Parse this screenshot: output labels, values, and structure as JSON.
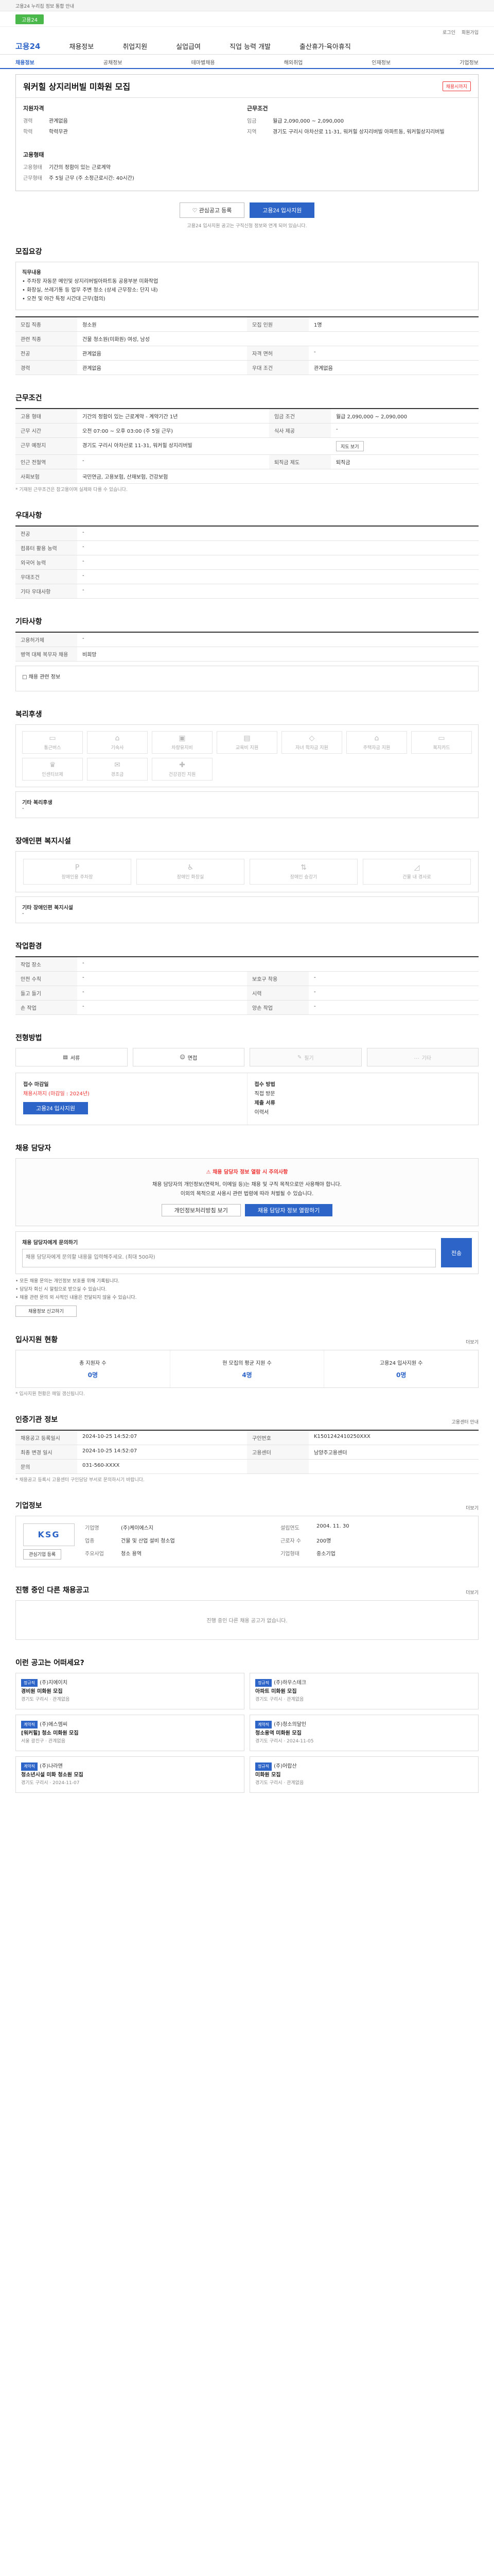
{
  "topbar": {
    "notice": "고용24 누리집 정보 통합 안내"
  },
  "banner": {
    "label": "고용24"
  },
  "util": [
    "로그인",
    "회원가입"
  ],
  "gnb": {
    "logo": "고용24",
    "menu": [
      "채용정보",
      "취업지원",
      "실업급여",
      "직업 능력 개발",
      "출산휴가·육아휴직"
    ]
  },
  "snb": [
    "채용정보",
    "공채정보",
    "테마별채용",
    "해외취업",
    "인재정보",
    "기업정보"
  ],
  "job": {
    "title": "워커힐 상지리버빌 미화원 모집",
    "status": "채용시까지",
    "left_head": "지원자격",
    "left": [
      {
        "k": "경력",
        "v": "관계없음"
      },
      {
        "k": "학력",
        "v": "학력무관"
      }
    ],
    "right_head": "근무조건",
    "right": [
      {
        "k": "임금",
        "v": "월급 2,090,000 ~ 2,090,000"
      },
      {
        "k": "지역",
        "v": "경기도 구리시 아차산로 11-31, 워커힐 상지리버빌 아파트동, 워커힐상지리버빌"
      }
    ],
    "corp_head": "고용형태",
    "corp": [
      {
        "k": "고용형태",
        "v": "기간의 정함이 있는 근로계약"
      },
      {
        "k": "근무형태",
        "v": "주 5일 근무 (주 소정근로시간: 40시간)"
      }
    ],
    "btn_scrap": "관심공고 등록",
    "btn_apply": "고용24 입사지원",
    "note": "고용24 입사지원 공고는 구직신청 정보와 연계 되어 있습니다."
  },
  "duty": {
    "title": "모집요강",
    "box_head": "직무내용",
    "box_lines": [
      "• 주차장 자동문 메인및 상지리버빌아파트동 공용부분 미화작업",
      "• 화장실, 쓰레기통 등 업무 주변 청소 (상세 근무장소: 단지 내)",
      "• 오전 및 야간 특정 시간대 근무(협의)"
    ],
    "rows": [
      {
        "k": "모집 직종",
        "v": "청소원"
      },
      {
        "k": "모집 인원",
        "v": "1명"
      },
      {
        "k": "관련 직종",
        "v": "건물 청소원(미화원) 여성, 남성"
      },
      {
        "k": "전공",
        "v": "관계없음"
      },
      {
        "k": "자격 면허",
        "v": "-"
      },
      {
        "k": "경력",
        "v": "관계없음"
      },
      {
        "k": "우대 조건",
        "v": "관계없음"
      }
    ]
  },
  "work": {
    "title": "근무조건",
    "rows": [
      {
        "k": "고용 형태",
        "v": "기간의 정함이 있는 근로계약 - 계약기간 1년"
      },
      {
        "k": "임금 조건",
        "v": "월급 2,090,000 ~ 2,090,000"
      },
      {
        "k": "근무 시간",
        "v": "오전 07:00 ~ 오후 03:00 (주 5일 근무)"
      },
      {
        "k": "식사 제공",
        "v": "-"
      },
      {
        "k": "근무 예정지",
        "v": "경기도 구리시 아차산로 11-31, 워커힐 상지리버빌"
      },
      {
        "k": "인근 전철역",
        "v": "-"
      },
      {
        "k": "퇴직금 제도",
        "v": "퇴직금"
      },
      {
        "k": "사회보험",
        "v": "국민연금, 고용보험, 산재보험, 건강보험"
      }
    ],
    "map_btn": "지도 보기",
    "note": "* 기재된 근무조건은 참고용이며 실제와 다를 수 있습니다."
  },
  "prefs": {
    "title": "우대사항",
    "rows": [
      {
        "k": "전공",
        "v": "-"
      },
      {
        "k": "컴퓨터 활용 능력",
        "v": "-"
      },
      {
        "k": "외국어 능력",
        "v": "-"
      },
      {
        "k": "우대조건",
        "v": "-"
      },
      {
        "k": "기타 우대사항",
        "v": "-"
      }
    ]
  },
  "etc": {
    "title": "기타사항",
    "rows": [
      {
        "k": "고용허가제",
        "v": "-"
      },
      {
        "k": "병역 대체 복무자 채용",
        "v": "비희망"
      }
    ],
    "extra": "□ 채용 관련 정보"
  },
  "welfare": {
    "title": "복리후생",
    "items": [
      "통근버스",
      "기숙사",
      "차량유지비",
      "교육비 지원",
      "자녀 학자금 지원",
      "주택자금 지원",
      "복지카드",
      "인센티브제",
      "경조금",
      "건강검진 지원"
    ],
    "other_head": "기타 복리후생",
    "other": "-"
  },
  "disability": {
    "title": "장애인편 복지시설",
    "items": [
      "장애인용 주차장",
      "장애인 화장실",
      "장애인 승강기",
      "건물 내 경사로"
    ],
    "other_head": "기타 장애인편 복지시설",
    "other": "-"
  },
  "workenv": {
    "title": "작업환경",
    "rows": [
      {
        "k": "작업 장소",
        "v": "-",
        "k2": "",
        "v2": ""
      },
      {
        "k": "안전 수칙",
        "v": "-",
        "k2": "보호구 착용",
        "v2": "-"
      },
      {
        "k": "들고 들기",
        "v": "-",
        "k2": "시력",
        "v2": "-"
      },
      {
        "k": "손 작업",
        "v": "-",
        "k2": "양손 작업",
        "v2": "-"
      }
    ]
  },
  "method": {
    "title": "전형방법",
    "items": [
      {
        "t": "서류",
        "dis": false
      },
      {
        "t": "면접",
        "dis": false
      },
      {
        "t": "필기",
        "dis": true
      },
      {
        "t": "기타",
        "dis": true
      }
    ],
    "col1_head": "접수 마감일",
    "col1_val": "채용시까지 (마감일 : 2024년)",
    "col1_btn": "고용24 입사지원",
    "col2_head": "접수 방법",
    "col2_val": "직접 방문",
    "col2_head2": "제출 서류",
    "col2_val2": "이력서"
  },
  "manager": {
    "title": "채용 담당자",
    "alert_head": "채용 담당자 정보 열람 시 주의사항",
    "alert_lines": [
      "채용 담당자의 개인정보(연락처, 이메일 등)는 채용 및 구직 목적으로만 사용해야 합니다.",
      "이외의 목적으로 사용시 관련 법령에 따라 처벌될 수 있습니다."
    ],
    "btn1": "개인정보처리방침 보기",
    "btn2": "채용 담당자 정보 열람하기",
    "form_head": "채용 담당자에게 문의하기",
    "form_placeholder": "채용 담당자에게 문의할 내용을 입력해주세요. (최대 500자)",
    "form_btn": "전송",
    "bullets": [
      "• 모든 채용 문의는 개인정보 보호를 위해 기록됩니다.",
      "• 담당자 회신 시 알림으로 받으실 수 있습니다.",
      "• 채용 관련 문의 외 사적인 내용은 전달되지 않을 수 있습니다."
    ],
    "btn3": "채용정보 신고하기"
  },
  "applicants": {
    "title": "입사지원 현황",
    "more": "더보기",
    "items": [
      {
        "k": "총 지원자 수",
        "v": "0명"
      },
      {
        "k": "현 모집의 평균 지원 수",
        "v": "4명"
      },
      {
        "k": "고용24 입사지원 수",
        "v": "0명"
      }
    ],
    "note": "* 입사지원 현황은 매일 갱신됩니다."
  },
  "regist": {
    "title": "인증기관 정보",
    "more": "고용센터 안내",
    "rows": [
      {
        "k": "채용공고 등록일시",
        "v": "2024-10-25 14:52:07",
        "k2": "구인번호",
        "v2": "K1501242410250XXX"
      },
      {
        "k": "최종 변경 일시",
        "v": "2024-10-25 14:52:07",
        "k2": "고용센터",
        "v2": "남양주고용센터"
      },
      {
        "k": "문의",
        "v": "031-560-XXXX",
        "k2": "",
        "v2": ""
      }
    ],
    "note": "* 채용공고 등록시 고용센터 구인담당 부서로 문의하시기 바랍니다."
  },
  "company": {
    "title": "기업정보",
    "more": "더보기",
    "logo": "KSG",
    "btn": "관심기업 등록",
    "rows": [
      {
        "k": "기업명",
        "v": "(주)케이에스지"
      },
      {
        "k": "설립연도",
        "v": "2004. 11. 30"
      },
      {
        "k": "업종",
        "v": "건물 및 산업 설비 청소업"
      },
      {
        "k": "근로자 수",
        "v": "200명"
      },
      {
        "k": "주요사업",
        "v": "청소 용역"
      },
      {
        "k": "기업형태",
        "v": "중소기업"
      }
    ]
  },
  "more_jobs": {
    "title": "진행 중인 다른 채용공고",
    "more": "더보기",
    "empty": "진행 중인 다른 채용 공고가 없습니다."
  },
  "recommend": {
    "title": "이런 공고는 어떠세요?",
    "items": [
      {
        "tag": "정규직",
        "company": "(주)지에이치",
        "t": "경비원 미화원 모집",
        "m1": "경기도 구리시",
        "m2": "관계없음"
      },
      {
        "tag": "정규직",
        "company": "(주)하우스테크",
        "t": "아파트 미화원 모집",
        "m1": "경기도 구리시",
        "m2": "관계없음"
      },
      {
        "tag": "계약직",
        "company": "(주)에스엠씨",
        "t": "[워커힐] 청소 미화원 모집",
        "m1": "서울 광진구",
        "m2": "관계없음"
      },
      {
        "tag": "계약직",
        "company": "(주)청소의달인",
        "t": "청소용역 미화원 모집",
        "m1": "경기도 구리시",
        "m2": "2024-11-05"
      },
      {
        "tag": "계약직",
        "company": "(주)나라앤",
        "t": "청소년시설 미화 청소원 모집",
        "m1": "경기도 구리시",
        "m2": "2024-11-07"
      },
      {
        "tag": "정규직",
        "company": "(주)어랍산",
        "t": "미화원 모집",
        "m1": "경기도 구리시",
        "m2": "관계없음"
      }
    ]
  }
}
